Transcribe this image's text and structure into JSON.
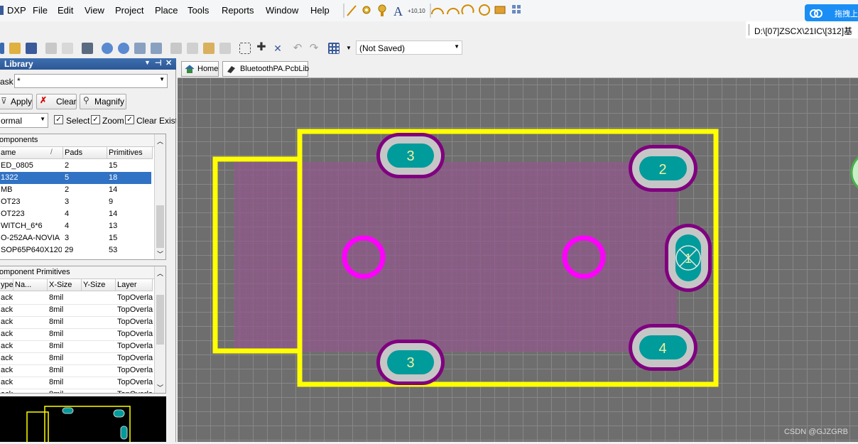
{
  "menu": {
    "dxp": "DXP",
    "file": "File",
    "edit": "Edit",
    "view": "View",
    "project": "Project",
    "place": "Place",
    "tools": "Tools",
    "reports": "Reports",
    "window": "Window",
    "help": "Help"
  },
  "cloud_button": "拖拽上",
  "path": "D:\\[07]ZSCX\\21IC\\[312]基",
  "toolbar": {
    "state": "(Not Saved)"
  },
  "panel": {
    "title": "Library",
    "mask_label": "ask",
    "mask_value": "*",
    "apply": "Apply",
    "clear": "Clear",
    "magnify": "Magnify",
    "mode": "ormal",
    "chk_select": "Select",
    "chk_zoom": "Zoom",
    "chk_clear": "Clear Existir",
    "components_title": "omponents",
    "components_headers": [
      "ame",
      "Pads",
      "Primitives"
    ],
    "components": [
      [
        "ED_0805",
        "2",
        "15"
      ],
      [
        "1322",
        "5",
        "18"
      ],
      [
        "MB",
        "2",
        "14"
      ],
      [
        "OT23",
        "3",
        "9"
      ],
      [
        "OT223",
        "4",
        "14"
      ],
      [
        "WITCH_6*6",
        "4",
        "13"
      ],
      [
        "O-252AA-NOVIA",
        "3",
        "15"
      ],
      [
        "SOP65P640X120_",
        "29",
        "53"
      ]
    ],
    "selected_component_index": 1,
    "primitives_title": "omponent Primitives",
    "primitives_headers": [
      "ype",
      "Na...",
      "X-Size",
      "Y-Size",
      "Layer"
    ],
    "primitives": [
      [
        "ack",
        "8mil",
        "TopOverla"
      ],
      [
        "ack",
        "8mil",
        "TopOverla"
      ],
      [
        "ack",
        "8mil",
        "TopOverla"
      ],
      [
        "ack",
        "8mil",
        "TopOverla"
      ],
      [
        "ack",
        "8mil",
        "TopOverla"
      ],
      [
        "ack",
        "8mil",
        "TopOverla"
      ],
      [
        "ack",
        "8mil",
        "TopOverla"
      ],
      [
        "ack",
        "8mil",
        "TopOverla"
      ],
      [
        "ack",
        "8mil",
        "TopOverla"
      ]
    ]
  },
  "tabs": {
    "home": "Home",
    "doc": "BluetoothPA.PcbLib"
  },
  "pads": {
    "p1": "1",
    "p2": "2",
    "p3a": "3",
    "p3b": "3",
    "p4": "4"
  },
  "watermark": "CSDN @GJZGRB",
  "colors": {
    "overlay": "#ffff00",
    "mech": "#ff00ff",
    "pad": "#009b9b",
    "canvas": "#6f6e6e"
  }
}
